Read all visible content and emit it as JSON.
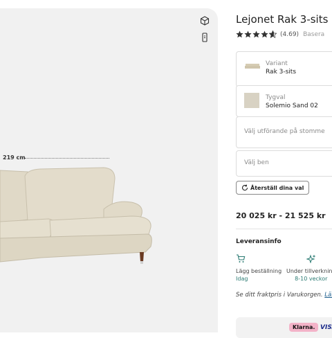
{
  "viewer": {
    "dimension_label": "219 cm",
    "icons": [
      "3d-cube-icon",
      "ar-view-icon"
    ]
  },
  "product": {
    "title": "Lejonet Rak 3-sits",
    "rating_value": "(4.69)",
    "rating_extra": "Basera",
    "rating_stars": 4.69
  },
  "options": {
    "variant": {
      "label": "Variant",
      "value": "Rak 3-sits"
    },
    "fabric": {
      "label": "Tygval",
      "value": "Solemio Sand 02"
    },
    "frame": {
      "placeholder": "Välj utförande på stomme"
    },
    "legs": {
      "placeholder": "Välj ben"
    }
  },
  "reset_label": "Återställ dina val",
  "price": "20 025 kr - 21 525 kr",
  "delivery": {
    "title": "Leveransinfo",
    "steps": [
      {
        "icon": "cart-icon",
        "title": "Lägg beställning",
        "sub": "Idag"
      },
      {
        "icon": "sparkle-icon",
        "title": "Under tillverkning",
        "sub": "8-10 veckor"
      }
    ]
  },
  "shipping_text": "Se ditt fraktpris i Varukorgen.",
  "shipping_link": "Läs",
  "payment": {
    "klarna": "Klarna.",
    "visa": "VISA"
  },
  "colors": {
    "accent": "#2a7a72",
    "sofa": "#e3dccb",
    "viewer_bg": "#f1f1f1"
  }
}
